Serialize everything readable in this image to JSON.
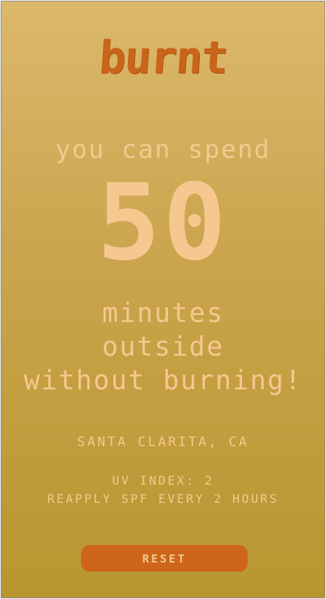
{
  "app": {
    "logo_text": "burnt"
  },
  "result": {
    "intro": "you can spend",
    "minutes": "50",
    "line1": "minutes",
    "line2": "outside",
    "line3": "without burning!"
  },
  "location": {
    "name": "SANTA CLARITA, CA"
  },
  "uv": {
    "index_text": "UV INDEX: 2",
    "advice": "REAPPLY SPF EVERY 2 HOURS"
  },
  "actions": {
    "reset_label": "RESET"
  },
  "colors": {
    "background_top": "#dcb86c",
    "background_bottom": "#b8962f",
    "logo": "#c9641b",
    "text": "#f6c88f",
    "button": "#cd661a"
  }
}
